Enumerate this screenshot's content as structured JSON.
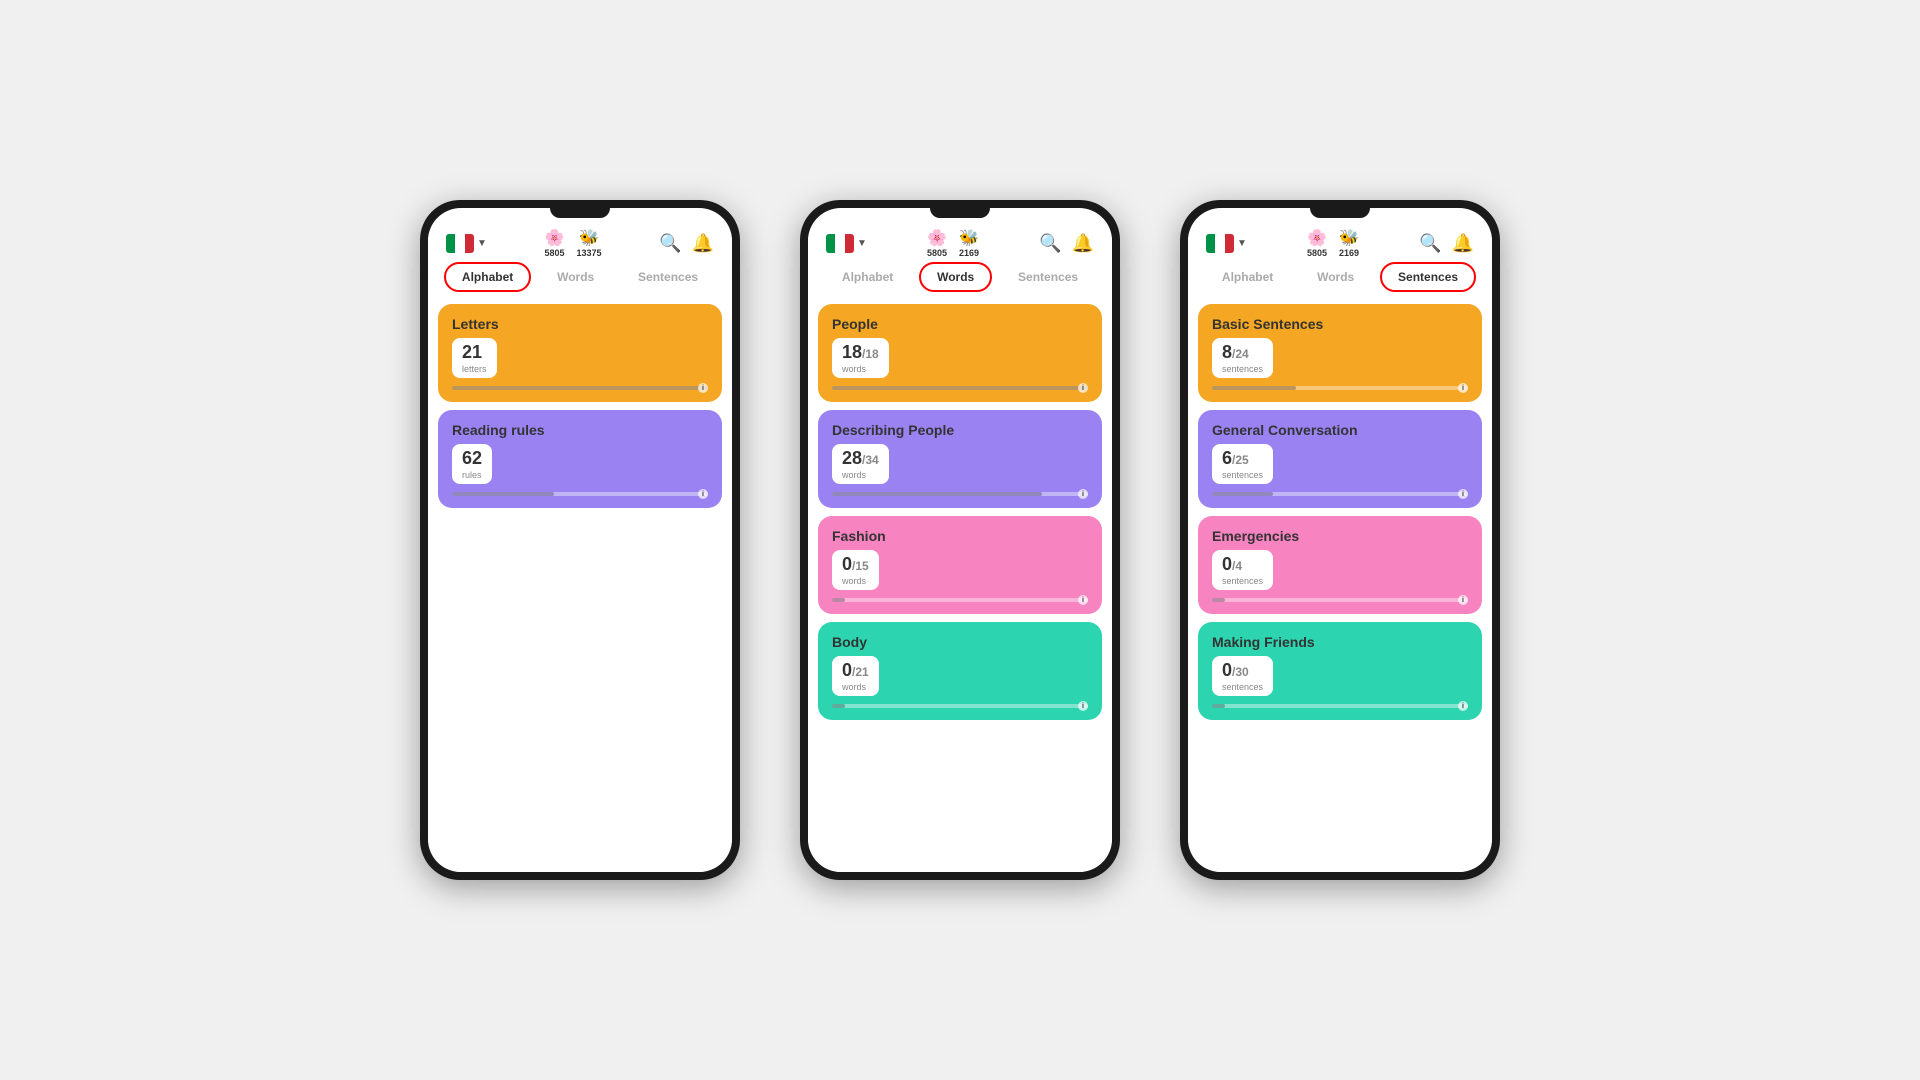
{
  "phones": [
    {
      "id": "phone-alphabet",
      "stats": [
        {
          "icon": "🌸",
          "value": "5805"
        },
        {
          "icon": "🐝",
          "value": "13375"
        }
      ],
      "activeTab": "Alphabet",
      "tabs": [
        "Alphabet",
        "Words",
        "Sentences"
      ],
      "cards": [
        {
          "title": "Letters",
          "count": "21",
          "total": "",
          "label": "letters",
          "color": "orange",
          "progress": 100,
          "illustration": "alphabet"
        },
        {
          "title": "Reading rules",
          "count": "62",
          "total": "",
          "label": "rules",
          "color": "purple",
          "progress": 40,
          "illustration": "reading"
        }
      ]
    },
    {
      "id": "phone-words",
      "stats": [
        {
          "icon": "🌸",
          "value": "5805"
        },
        {
          "icon": "🐝",
          "value": "2169"
        }
      ],
      "activeTab": "Words",
      "tabs": [
        "Alphabet",
        "Words",
        "Sentences"
      ],
      "cards": [
        {
          "title": "People",
          "count": "18",
          "total": "/18",
          "label": "words",
          "color": "orange",
          "progress": 100,
          "illustration": "people"
        },
        {
          "title": "Describing People",
          "count": "28",
          "total": "/34",
          "label": "words",
          "color": "purple",
          "progress": 82,
          "illustration": "describing"
        },
        {
          "title": "Fashion",
          "count": "0",
          "total": "/15",
          "label": "words",
          "color": "pink",
          "progress": 5,
          "illustration": "fashion"
        },
        {
          "title": "Body",
          "count": "0",
          "total": "/21",
          "label": "words",
          "color": "teal",
          "progress": 5,
          "illustration": "body"
        }
      ]
    },
    {
      "id": "phone-sentences",
      "stats": [
        {
          "icon": "🌸",
          "value": "5805"
        },
        {
          "icon": "🐝",
          "value": "2169"
        }
      ],
      "activeTab": "Sentences",
      "tabs": [
        "Alphabet",
        "Words",
        "Sentences"
      ],
      "cards": [
        {
          "title": "Basic Sentences",
          "count": "8",
          "total": "/24",
          "label": "sentences",
          "color": "orange",
          "progress": 33,
          "illustration": "basic"
        },
        {
          "title": "General Conversation",
          "count": "6",
          "total": "/25",
          "label": "sentences",
          "color": "purple",
          "progress": 24,
          "illustration": "convo"
        },
        {
          "title": "Emergencies",
          "count": "0",
          "total": "/4",
          "label": "sentences",
          "color": "pink",
          "progress": 5,
          "illustration": "emergency"
        },
        {
          "title": "Making Friends",
          "count": "0",
          "total": "/30",
          "label": "sentences",
          "color": "teal",
          "progress": 5,
          "illustration": "friends"
        }
      ]
    }
  ]
}
